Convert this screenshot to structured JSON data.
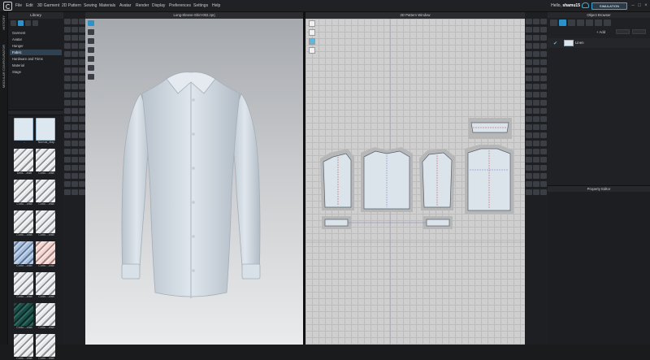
{
  "menu": {
    "items": [
      "File",
      "Edit",
      "3D Garment",
      "2D Pattern",
      "Sewing",
      "Materials",
      "Avatar",
      "Render",
      "Display",
      "Preferences",
      "Settings",
      "Help"
    ],
    "greeting": "Hello, ",
    "username": "shamu15",
    "mode_button": "SIMULATION"
  },
  "left_strip": {
    "history": "HISTORY",
    "modular": "MODULAR CONFIGURATOR"
  },
  "library": {
    "title": "Library",
    "items": [
      "Garment",
      "Avatar",
      "Hanger",
      "Fabric",
      "Hardware and Trims",
      "Material",
      "Stage"
    ],
    "selected": "Fabric",
    "thumbnails": [
      {
        "label": "..",
        "kind": "folder"
      },
      {
        "label": "Normal_Map",
        "kind": "folder"
      },
      {
        "label": "Defa....zfab",
        "kind": "white"
      },
      {
        "label": "Cotto....zfab",
        "kind": "white"
      },
      {
        "label": "Cotto....zfab",
        "kind": "white"
      },
      {
        "label": "Cotto....zfab",
        "kind": "white"
      },
      {
        "label": "Cotto....zfab",
        "kind": "white"
      },
      {
        "label": "Cotto....zfab",
        "kind": "white"
      },
      {
        "label": "Cotto....zfab",
        "kind": "blue"
      },
      {
        "label": "Cotto....zfab",
        "kind": "pink"
      },
      {
        "label": "Cotto....zfab",
        "kind": "white"
      },
      {
        "label": "Cotto....zfab",
        "kind": "white"
      },
      {
        "label": "Cotto....zfab",
        "kind": "green"
      },
      {
        "label": "Cotto....zfab",
        "kind": "white"
      },
      {
        "label": "Cotto....zfab",
        "kind": "white"
      },
      {
        "label": "Cotto....zfab",
        "kind": "white"
      }
    ]
  },
  "view3d": {
    "title": "Long-Sleeve-Shirt-002.zprj"
  },
  "view2d": {
    "title": "2D Pattern Window"
  },
  "object_browser": {
    "title": "Object Browser",
    "add_label": "+ Add",
    "fabric_name": "Linen"
  },
  "property_editor": {
    "title": "Property Editor"
  },
  "colors": {
    "accent": "#2b93c9",
    "shirt": "#dbe3eb",
    "pattern_bg": "#cfcfcf"
  }
}
